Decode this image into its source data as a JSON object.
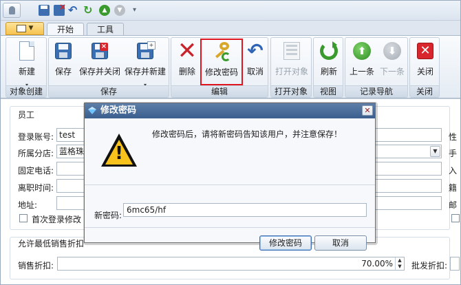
{
  "quick_access": {
    "icons": [
      "user-icon",
      "save-icon",
      "delete-icon",
      "undo-icon",
      "refresh-icon",
      "up-icon",
      "down-icon",
      "more-icon"
    ]
  },
  "tabs": {
    "home": "开始",
    "tools": "工具"
  },
  "ribbon": {
    "groups": {
      "create": "对象创建",
      "save": "保存",
      "edit": "编辑",
      "open": "打开对象",
      "view": "视图",
      "nav": "记录导航",
      "close": "关闭"
    },
    "buttons": {
      "new": "新建",
      "save": "保存",
      "save_close": "保存并关闭",
      "save_new": "保存并新建",
      "delete": "删除",
      "change_password": "修改密码",
      "cancel": "取消",
      "open_object": "打开对象",
      "refresh": "刷新",
      "prev": "上一条",
      "next": "下一条",
      "close": "关闭"
    }
  },
  "form": {
    "section_employee": "员工",
    "fields": {
      "login_label": "登录账号:",
      "login_value": "test",
      "branch_label": "所属分店:",
      "branch_value": "蓝格珠",
      "phone_label": "固定电话:",
      "leave_label": "离职时间:",
      "address_label": "地址:",
      "first_login_label": "首次登录修改",
      "right_label_1": "性",
      "right_label_2": "手",
      "right_label_3": "入",
      "right_label_4": "籍",
      "right_label_5": "邮"
    },
    "section_discount": "允许最低销售折扣",
    "discount": {
      "sales_label": "销售折扣:",
      "sales_value": "70.00%",
      "wholesale_label": "批发折扣:"
    }
  },
  "dialog": {
    "title": "修改密码",
    "message": "修改密码后，请将新密码告知该用户，并注意保存！",
    "new_password_label": "新密码:",
    "new_password_value": "6mc65/hf",
    "ok_label": "修改密码",
    "cancel_label": "取消"
  }
}
